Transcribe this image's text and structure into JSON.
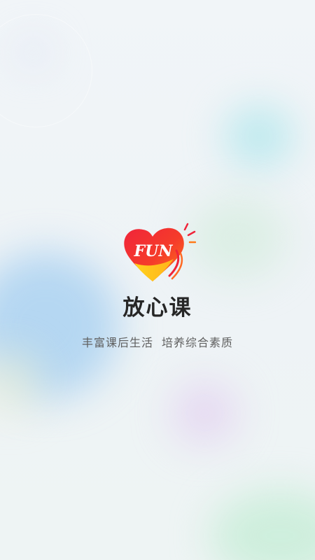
{
  "splash": {
    "logo_text": "FUN",
    "app_name": "放心课",
    "tagline_left": "丰富课后生活",
    "tagline_right": "培养综合素质"
  },
  "colors": {
    "background": "#eef3f6",
    "logo_red": "#f0243a",
    "logo_orange": "#ff7a1a",
    "logo_yellow": "#ffd21e",
    "title": "#262626",
    "subtitle": "#5f5f5f"
  },
  "icons": {
    "logo": "heart-fun-logo-icon"
  }
}
